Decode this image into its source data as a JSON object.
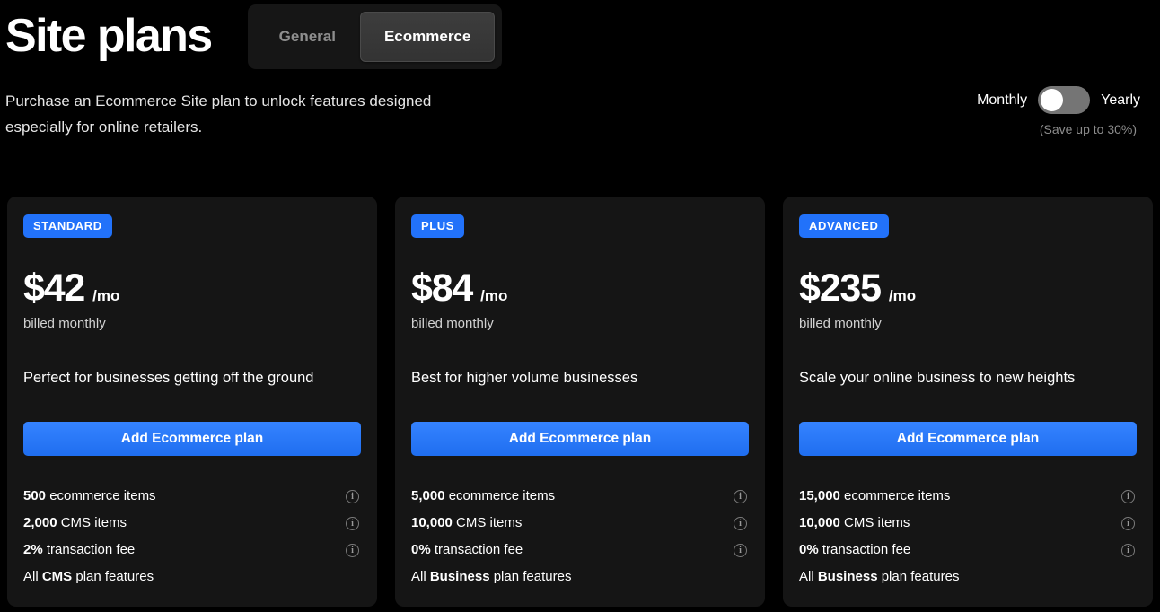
{
  "header": {
    "title": "Site plans",
    "tabs": [
      {
        "label": "General",
        "active": false
      },
      {
        "label": "Ecommerce",
        "active": true
      }
    ]
  },
  "subheader": {
    "description": "Purchase an Ecommerce Site plan to unlock features designed especially for online retailers.",
    "billing": {
      "monthly_label": "Monthly",
      "yearly_label": "Yearly",
      "selected": "Monthly",
      "save_note": "(Save up to 30%)"
    }
  },
  "colors": {
    "page_background": "#000000",
    "card_background": "#151515",
    "accent_blue": "#2272fa",
    "cta_blue": "#2272fa",
    "tab_active_background": "#3a3a3a",
    "toggle_track": "#757575"
  },
  "plans": [
    {
      "badge": "STANDARD",
      "price": "$42",
      "per": "/mo",
      "billed": "billed monthly",
      "tagline": "Perfect for businesses getting off the ground",
      "cta": "Add Ecommerce plan",
      "features": [
        {
          "bold": "500",
          "rest": " ecommerce items",
          "info": true
        },
        {
          "bold": "2,000",
          "rest": " CMS items",
          "info": true
        },
        {
          "bold": "2%",
          "rest": " transaction fee",
          "info": true
        },
        {
          "pre": "All ",
          "bold": "CMS",
          "rest": " plan features",
          "info": false
        }
      ]
    },
    {
      "badge": "PLUS",
      "price": "$84",
      "per": "/mo",
      "billed": "billed monthly",
      "tagline": "Best for higher volume businesses",
      "cta": "Add Ecommerce plan",
      "features": [
        {
          "bold": "5,000",
          "rest": " ecommerce items",
          "info": true
        },
        {
          "bold": "10,000",
          "rest": " CMS items",
          "info": true
        },
        {
          "bold": "0%",
          "rest": " transaction fee",
          "info": true
        },
        {
          "pre": "All ",
          "bold": "Business",
          "rest": " plan features",
          "info": false
        }
      ]
    },
    {
      "badge": "ADVANCED",
      "price": "$235",
      "per": "/mo",
      "billed": "billed monthly",
      "tagline": "Scale your online business to new heights",
      "cta": "Add Ecommerce plan",
      "features": [
        {
          "bold": "15,000",
          "rest": " ecommerce items",
          "info": true
        },
        {
          "bold": "10,000",
          "rest": " CMS items",
          "info": true
        },
        {
          "bold": "0%",
          "rest": " transaction fee",
          "info": true
        },
        {
          "pre": "All ",
          "bold": "Business",
          "rest": " plan features",
          "info": false
        }
      ]
    }
  ],
  "icons": {
    "info": "info-circle-icon"
  }
}
